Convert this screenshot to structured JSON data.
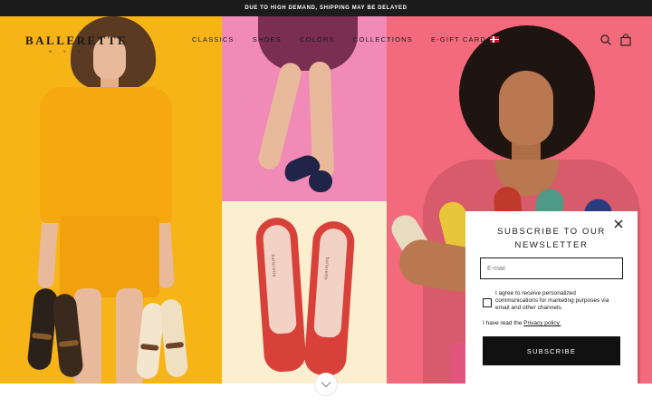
{
  "announcement": {
    "text": "DUE TO HIGH DEMAND, SHIPPING MAY BE DELAYED"
  },
  "header": {
    "logo_text": "BALLERETTE",
    "logo_sub": "N Y C",
    "nav": [
      "CLASSICS",
      "SHOES",
      "COLORS",
      "COLLECTIONS",
      "E-GIFT CARD"
    ],
    "icons": [
      "denmark-flag-icon",
      "search-icon",
      "bag-icon"
    ]
  },
  "popup": {
    "title": "SUBSCRIBE TO OUR NEWSLETTER",
    "email_placeholder": "E-mail",
    "consent_text": "I agree to receive personalized communications for marketing purposes via email and other channels.",
    "privacy_prefix": "I have read the ",
    "privacy_link": "Privacy policy.",
    "subscribe_label": "SUBSCRIBE",
    "close_icon": "close-icon"
  },
  "hero": {
    "product_mark": "ballerette"
  },
  "colors": {
    "announcement_bg": "#1c1c1c",
    "yellow_panel": "#f7b417",
    "pink_panel": "#f18ab6",
    "cream_panel": "#fbefcf",
    "coral_panel": "#f26a7b",
    "button_bg": "#111111"
  }
}
